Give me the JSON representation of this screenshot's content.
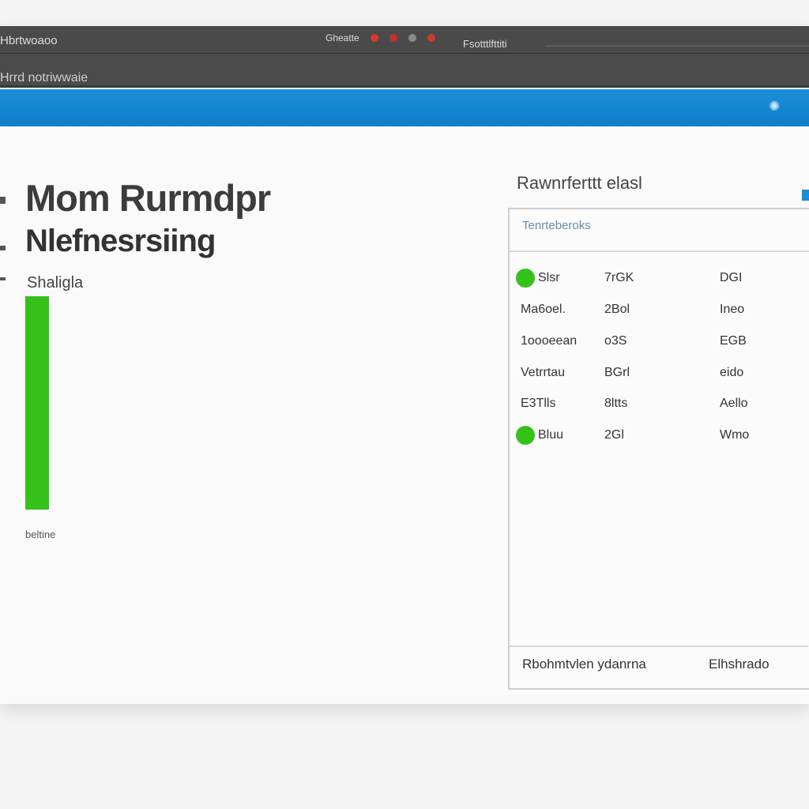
{
  "titlebar": {
    "app_title": "Hbrtwoaoo",
    "status_text": "Gheatte",
    "right_text": "Fsotttlfttiti",
    "dot_colors": [
      "#d93a2b",
      "#c03030",
      "#8a8a8a",
      "#d13a2a"
    ]
  },
  "subbar": {
    "label": "Hrrd notriwwaie"
  },
  "bluebar": {
    "settings_icon": "gear-icon"
  },
  "main": {
    "title": "Mom Rurmdpr",
    "subtitle": "Nlefnesrsiing",
    "chart_label": "Shaligla",
    "chart_footer": "beltine",
    "progress_fraction": 1.0,
    "bar_color": "#35c119"
  },
  "panel": {
    "title": "Rawnrferttt elasl",
    "header": "Tenrteberoks",
    "rows": [
      {
        "c1": "Slsr",
        "c2": "7rGK",
        "c3": "DGI",
        "status": true
      },
      {
        "c1": "Ma6oel.",
        "c2": "2Bol",
        "c3": "Ineo",
        "status": false
      },
      {
        "c1": "1oooeean",
        "c2": "o3S",
        "c3": "EGB",
        "status": false
      },
      {
        "c1": "Vetrrtau",
        "c2": "BGrl",
        "c3": "eido",
        "status": false
      },
      {
        "c1": "E3Tlls",
        "c2": "8ltts",
        "c3": "Aello",
        "status": false
      },
      {
        "c1": "Bluu",
        "c2": "2Gl",
        "c3": "Wmo",
        "status": true
      }
    ],
    "footer_left": "Rbohmtvlen ydanrna",
    "footer_right": "Elhshrado",
    "status_color": "#34c21a"
  }
}
